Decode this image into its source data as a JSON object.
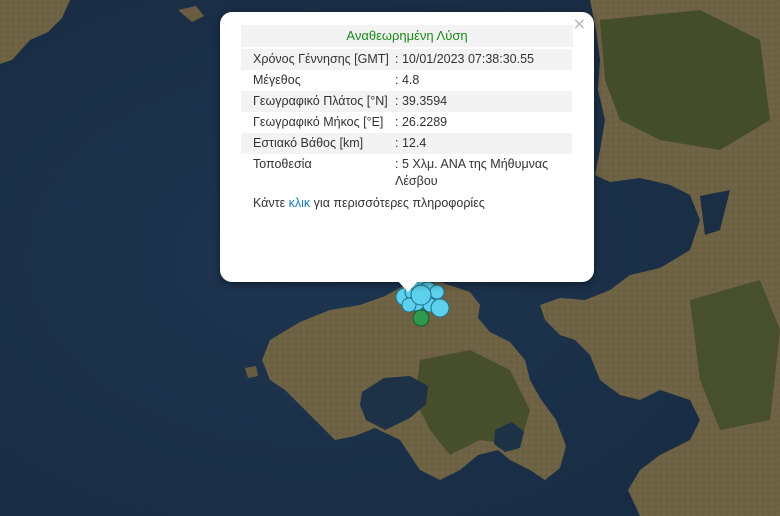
{
  "popup": {
    "title": "Αναθεωρημένη Λύση",
    "close_glyph": "×",
    "rows": [
      {
        "label": "Χρόνος Γέννησης [GMT]",
        "value": ": 10/01/2023 07:38:30.55"
      },
      {
        "label": "Μέγεθος",
        "value": ": 4.8"
      },
      {
        "label": "Γεωγραφικό Πλάτος [°N]",
        "value": ": 39.3594"
      },
      {
        "label": "Γεωγραφικό Μήκος [°E]",
        "value": ": 26.2289"
      },
      {
        "label": "Εστιακό Βάθος [km]",
        "value": ": 12.4"
      },
      {
        "label": "Τοποθεσία",
        "value": ": 5 Χλμ. ΑΝΑ της Μήθυμνας Λέσβου"
      }
    ],
    "more_prefix": "Κάντε",
    "more_link": "κλικ",
    "more_suffix": "για περισσότερες πληροφορίες"
  },
  "map": {
    "sea_color": "#1b2e44",
    "land_color": "#6e6244",
    "forest_color": "#3d4a27",
    "marker_colors": {
      "recent": "#5cd0ec",
      "main": "#2e9a4e"
    }
  }
}
